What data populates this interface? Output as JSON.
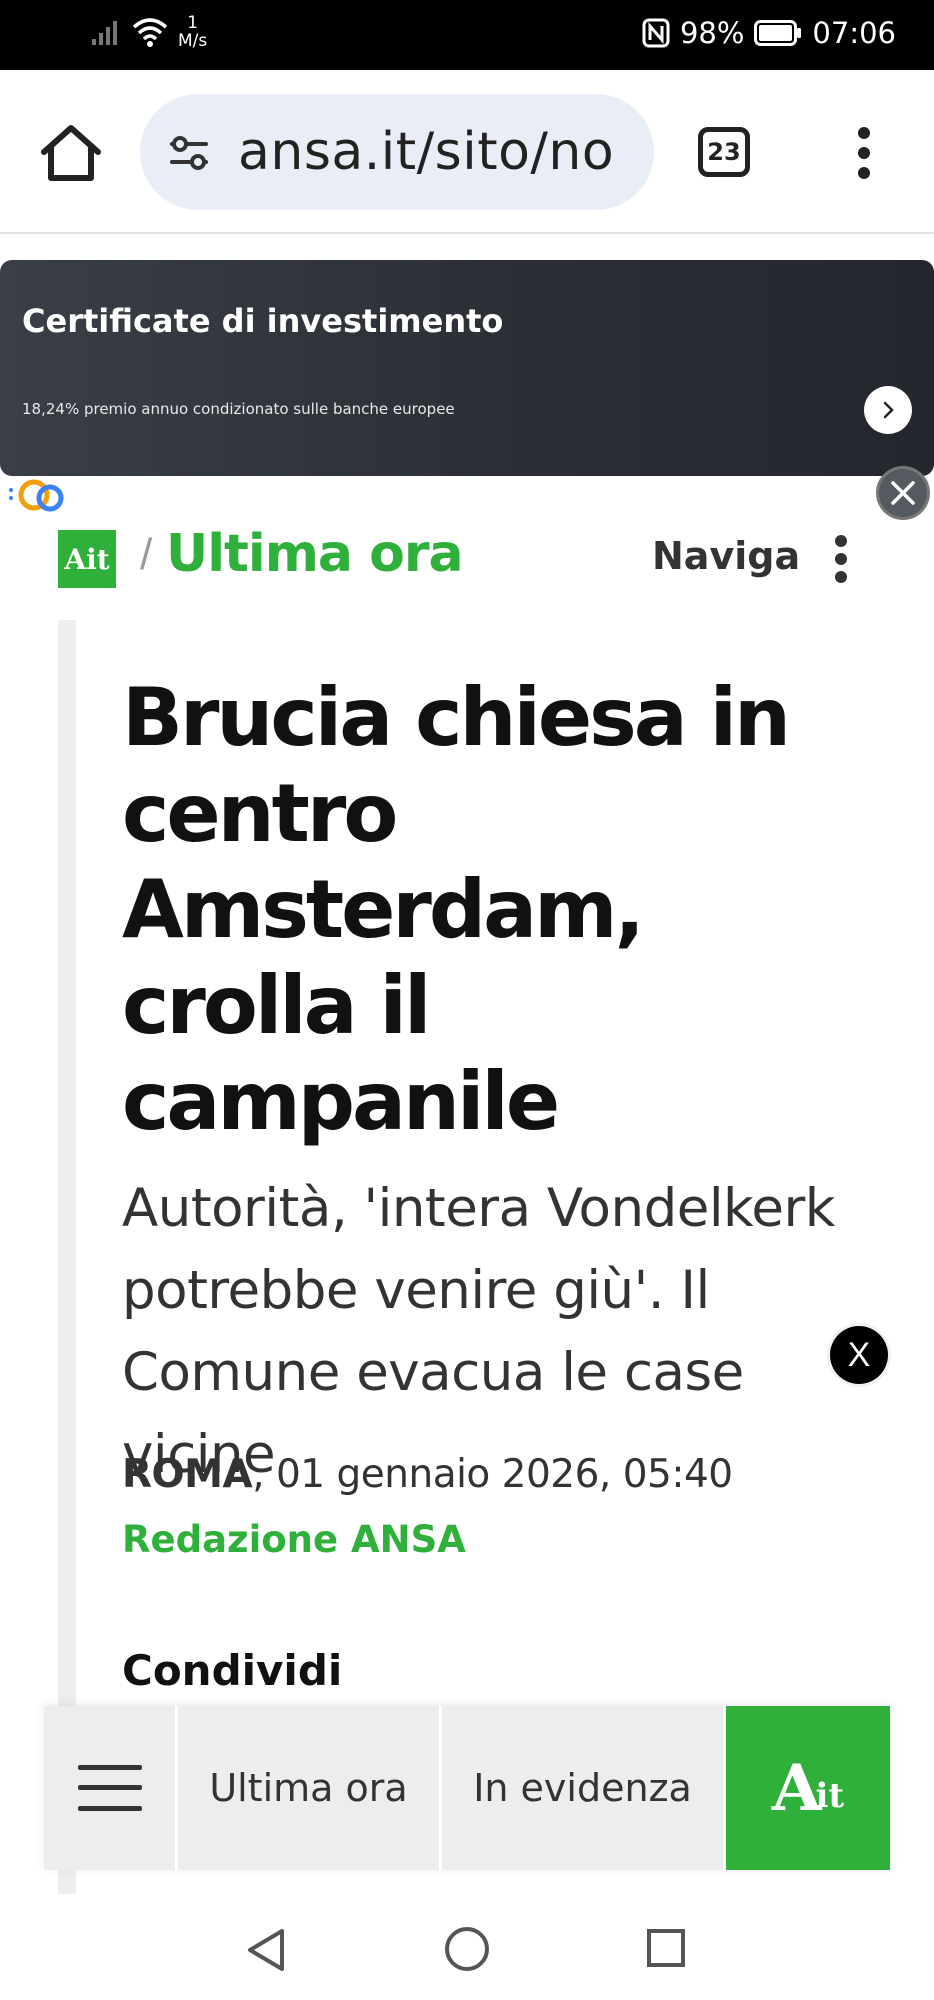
{
  "status_bar": {
    "speed_value": "1",
    "speed_unit": "M/s",
    "battery": "98%",
    "time": "07:06"
  },
  "browser": {
    "url": "ansa.it/sito/no",
    "tab_count": "23"
  },
  "ad": {
    "title": "Certificate di investimento",
    "subtitle": "18,24% premio annuo condizionato sulle banche europee"
  },
  "section": {
    "logo": "Ait",
    "title": "Ultima ora",
    "nav_label": "Naviga"
  },
  "article": {
    "headline": "Brucia chiesa in centro Amsterdam, crolla il campanile",
    "subtitle": "Autorità, 'intera Vondelkerk potrebbe venire giù'. Il Comune evacua le case vicine",
    "city": "ROMA",
    "date": ", 01 gennaio 2026, 05:40",
    "author": "Redazione ANSA",
    "share_label": "Condividi",
    "float_close": "X"
  },
  "bottom_nav": {
    "ultima_ora": "Ultima ora",
    "in_evidenza": "In evidenza",
    "logo_main": "A",
    "logo_small": "it"
  }
}
